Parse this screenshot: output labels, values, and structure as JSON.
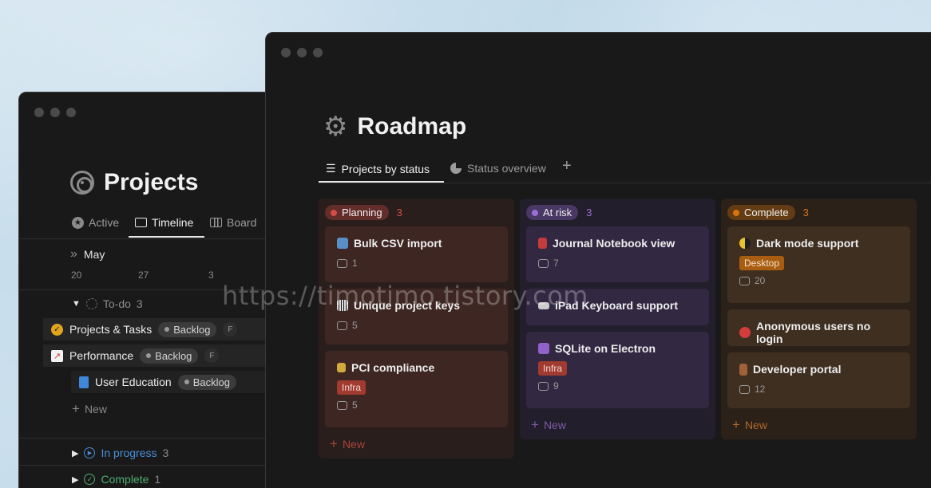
{
  "projects": {
    "title": "Projects",
    "tabs": [
      {
        "label": "Active"
      },
      {
        "label": "Timeline"
      },
      {
        "label": "Board"
      }
    ],
    "month": "May",
    "days": [
      "20",
      "27",
      "3"
    ],
    "todo": {
      "label": "To-do",
      "count": "3"
    },
    "rows": [
      {
        "name": "Projects & Tasks",
        "status": "Backlog",
        "fav": "F"
      },
      {
        "name": "Performance",
        "status": "Backlog",
        "fav": "F"
      },
      {
        "name": "User Education",
        "status": "Backlog"
      }
    ],
    "new_label": "New",
    "in_progress": {
      "label": "In progress",
      "count": "3"
    },
    "complete": {
      "label": "Complete",
      "count": "1"
    }
  },
  "roadmap": {
    "title": "Roadmap",
    "tabs": [
      {
        "label": "Projects by status"
      },
      {
        "label": "Status overview"
      }
    ],
    "add_tab": "+",
    "columns": [
      {
        "status": "Planning",
        "count": "3",
        "color": "#d44c47",
        "bg": "#2a1e1c",
        "cardbg": "#3e2723",
        "cards": [
          {
            "icon": "sync-icon",
            "iconColor": "#5a8ec7",
            "title": "Bulk CSV import",
            "comments": "1"
          },
          {
            "icon": "piano-icon",
            "iconColor": "#dddddd",
            "title": "Unique project keys",
            "comments": "5"
          },
          {
            "icon": "lock-icon",
            "iconColor": "#d4a93c",
            "title": "PCI compliance",
            "chip": "Infra",
            "chipColor": "#a13a2f",
            "comments": "5"
          }
        ],
        "new": "New"
      },
      {
        "status": "At risk",
        "count": "3",
        "color": "#9a6dd7",
        "bg": "#231e2b",
        "cardbg": "#332842",
        "cards": [
          {
            "icon": "book-icon",
            "iconColor": "#c53b3b",
            "title": "Journal Notebook view",
            "comments": "7"
          },
          {
            "icon": "keyboard-icon",
            "iconColor": "#cccccc",
            "title": "iPad Keyboard support"
          },
          {
            "icon": "atom-icon",
            "iconColor": "#8f63c9",
            "title": "SQLite on Electron",
            "chip": "Infra",
            "chipColor": "#a13a2f",
            "comments": "9"
          }
        ],
        "new": "New"
      },
      {
        "status": "Complete",
        "count": "3",
        "color": "#d9730d",
        "bg": "#2b2119",
        "cardbg": "#3f2f21",
        "cards": [
          {
            "icon": "moon-icon",
            "iconColor": "#e8c32e",
            "title": "Dark mode support",
            "chip": "Desktop",
            "chipColor": "#a85d10",
            "comments": "20"
          },
          {
            "icon": "no-entry-icon",
            "iconColor": "#d23c3c",
            "title": "Anonymous users no login"
          },
          {
            "icon": "door-icon",
            "iconColor": "#a0603a",
            "title": "Developer portal",
            "comments": "12"
          }
        ],
        "new": "New"
      }
    ]
  },
  "watermark": "https://timotimo.tistory.com"
}
